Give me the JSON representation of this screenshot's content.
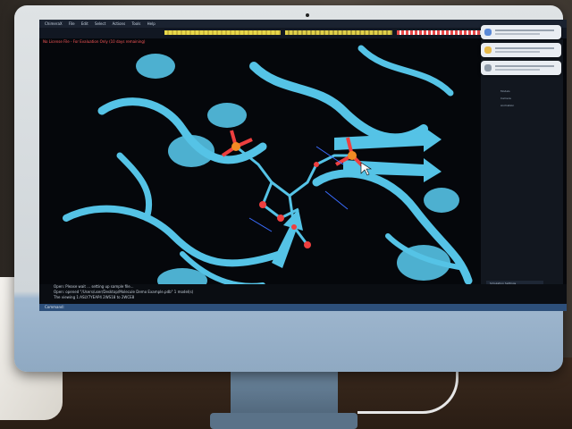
{
  "menu": {
    "items": [
      "ChimeraX",
      "File",
      "Edit",
      "Select",
      "Actions",
      "Tools",
      "Help"
    ]
  },
  "license_notice": "No License File - For Evaluation Only (10 days remaining)",
  "console": {
    "lines": [
      "Open: Please wait ... setting up sample file...",
      "Open: opened \"/Users/user/Desktop/Molecule Demo Example.pdb\" 1 model(s)",
      "The viewing 1:ASLY7YEAP4 2WS18 to 2WCE8"
    ]
  },
  "command_prompt": "Command:",
  "side_panel": {
    "items": [
      "Models",
      "Camera",
      "Animation"
    ],
    "button": "Simulation Settings"
  },
  "colors": {
    "ribbon": "#55c3e6",
    "phosphorus": "#f08a24",
    "oxygen": "#ee3f3f",
    "background": "#05070b",
    "selection": "#3a6cff"
  }
}
